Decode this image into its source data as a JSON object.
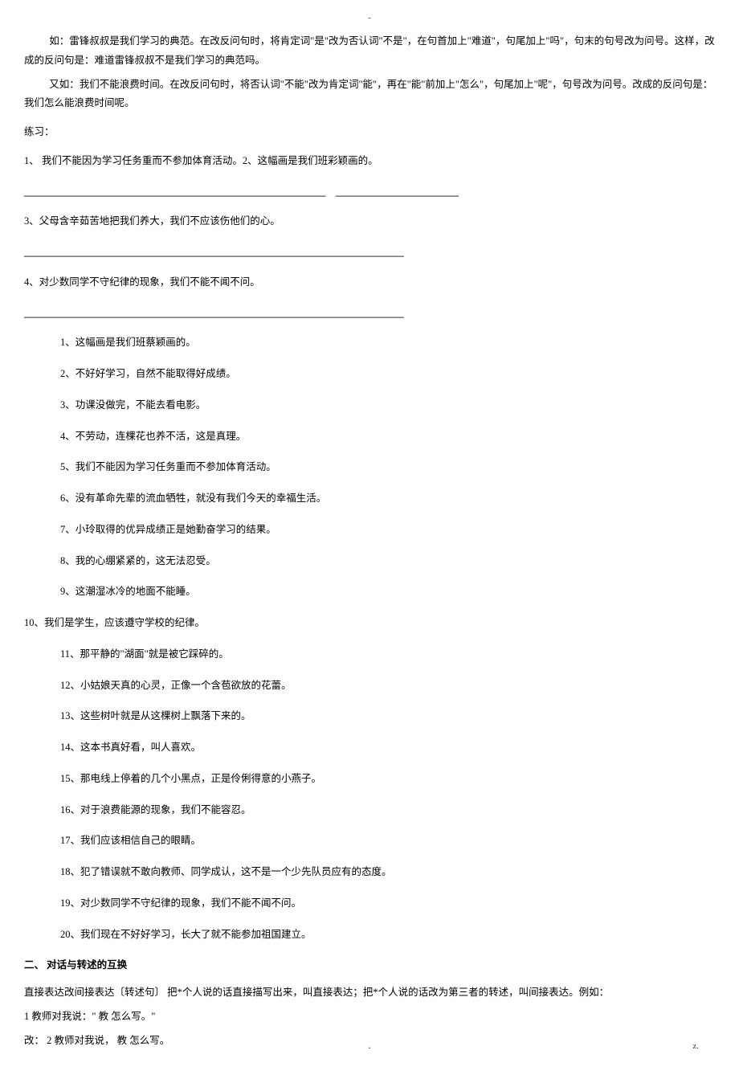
{
  "header": {
    "mark": "-"
  },
  "intro": {
    "example1": "如：雷锋叔叔是我们学习的典范。在改反问句时，将肯定词\"是\"改为否认词\"不是\"，在句首加上\"难道\"，句尾加上\"吗\"，句末的句号改为问号。这样，改成的反问句是：难道雷锋叔叔不是我们学习的典范吗。",
    "example2": "又如：我们不能浪费时间。在改反问句时，将否认词\"不能\"改为肯定词\"能\"，再在\"能\"前加上\"怎么\"，句尾加上\"呢\"，句号改为问号。改成的反问句是：我们怎么能浪费时间呢。"
  },
  "practice": {
    "label": "练习：",
    "q1_2": "1、 我们不能因为学习任务重而不参加体育活动。2、这幅画是我们班彩颖画的。",
    "blank1": "______________________________________________________　______________________",
    "q3": "3、父母含辛茹苦地把我们养大，我们不应该伤他们的心。",
    "blank3": "____________________________________________________________________",
    "q4": "4、对少数同学不守纪律的现象，我们不能不闻不问。",
    "blank4": "____________________________________________________________________"
  },
  "list": {
    "items": [
      "1、这幅画是我们班蔡颖画的。",
      "2、不好好学习，自然不能取得好成绩。",
      "3、功课没做完，不能去看电影。",
      "4、不劳动，连棵花也养不活，这是真理。",
      "5、我们不能因为学习任务重而不参加体育活动。",
      "6、没有革命先辈的流血牺牲，就没有我们今天的幸福生活。",
      "7、小玲取得的优异成绩正是她勤奋学习的结果。",
      "8、我的心绷紧紧的，这无法忍受。",
      "9、这潮湿冰冷的地面不能睡。"
    ],
    "item10": "10、我们是学生，应该遵守学校的纪律。",
    "items2": [
      "11、那平静的\"湖面\"就是被它踩碎的。",
      "12、小姑娘天真的心灵，正像一个含苞欲放的花蕾。",
      "13、这些树叶就是从这棵树上飘落下来的。",
      "14、这本书真好看，叫人喜欢。",
      "15、那电线上停着的几个小黑点，正是伶俐得意的小燕子。",
      "16、对于浪费能源的现象，我们不能容忍。",
      "17、我们应该相信自己的眼睛。",
      "18、犯了错误就不敢向教师、同学成认，这不是一个少先队员应有的态度。",
      "19、对少数同学不守纪律的现象，我们不能不闻不问。",
      "20、我们现在不好好学习，长大了就不能参加祖国建立。"
    ]
  },
  "section2": {
    "title": "二、 对话与转述的互换",
    "desc": "直接表达改间接表达〔转述句〕 把*个人说的话直接描写出来，叫直接表达；把*个人说的话改为第三者的转述，叫间接表达。例如：",
    "ex1": " 1 教师对我说：\" 教 怎么写。\"",
    "ex2": "改： 2 教师对我说，  教 怎么写。"
  },
  "footer": {
    "dot": ".",
    "z": "z."
  }
}
